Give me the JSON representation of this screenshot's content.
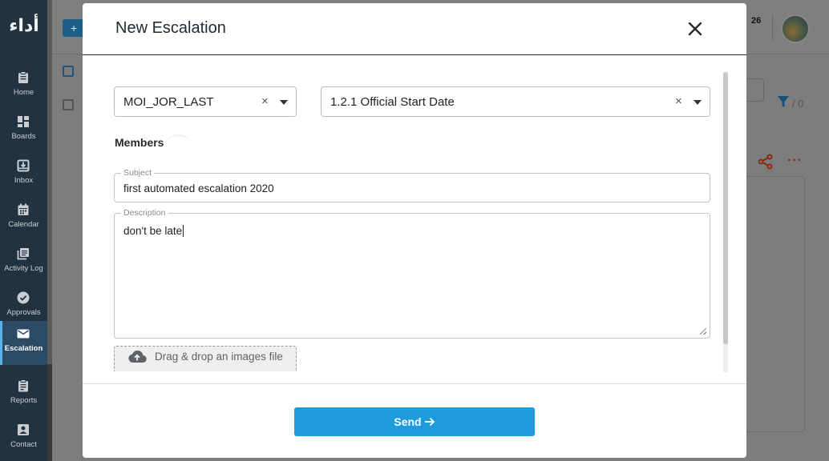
{
  "sidebar": {
    "logo_text": "أداء",
    "items": [
      {
        "label": "Home",
        "icon": "home-icon"
      },
      {
        "label": "Boards",
        "icon": "boards-icon"
      },
      {
        "label": "Inbox",
        "icon": "inbox-icon"
      },
      {
        "label": "Calendar",
        "icon": "calendar-icon"
      },
      {
        "label": "Activity Log",
        "icon": "activity-log-icon"
      },
      {
        "label": "Approvals",
        "icon": "check-circle-icon"
      },
      {
        "label": "Escalation",
        "icon": "mail-icon",
        "active": true
      },
      {
        "label": "Reports",
        "icon": "clipboard-icon"
      },
      {
        "label": "Contact",
        "icon": "contact-card-icon"
      }
    ]
  },
  "background": {
    "add_button_label": "+",
    "notification_count": "26",
    "filter_count": "/ 0",
    "more_label": "···"
  },
  "modal": {
    "title": "New Escalation",
    "project_select": {
      "value": "MOI_JOR_LAST",
      "clear": "×"
    },
    "milestone_select": {
      "value": "1.2.1 Official Start Date",
      "clear": "×"
    },
    "members_label": "Members",
    "subject": {
      "label": "Subject",
      "value": "first automated escalation 2020"
    },
    "description": {
      "label": "Description",
      "value": "don't be late"
    },
    "dropzone_text": "Drag & drop an images file",
    "send_label": "Send"
  },
  "colors": {
    "sidebar_bg": "#233240",
    "accent": "#1e9bdc",
    "active_indicator": "#5bb1ea"
  }
}
